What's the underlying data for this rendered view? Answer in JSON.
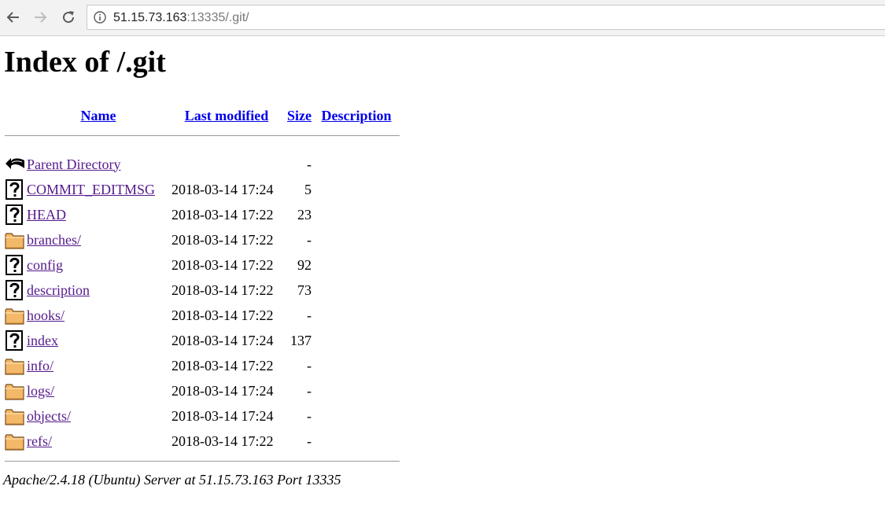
{
  "browser": {
    "url_host": "51.15.73.163",
    "url_rest": ":13335/.git/",
    "back_icon": "arrow-left-icon",
    "forward_icon": "arrow-right-icon",
    "reload_icon": "reload-icon",
    "info_icon": "info-circle-icon"
  },
  "page": {
    "title": "Index of /.git",
    "headers": {
      "name": "Name",
      "last_modified": "Last modified",
      "size": "Size",
      "description": "Description"
    },
    "entries": [
      {
        "icon": "back-arrow-icon",
        "name": "Parent Directory",
        "modified": "",
        "size": "-"
      },
      {
        "icon": "unknown-file-icon",
        "name": "COMMIT_EDITMSG",
        "modified": "2018-03-14 17:24",
        "size": "5"
      },
      {
        "icon": "unknown-file-icon",
        "name": "HEAD",
        "modified": "2018-03-14 17:22",
        "size": "23"
      },
      {
        "icon": "folder-icon",
        "name": "branches/",
        "modified": "2018-03-14 17:22",
        "size": "-"
      },
      {
        "icon": "unknown-file-icon",
        "name": "config",
        "modified": "2018-03-14 17:22",
        "size": "92"
      },
      {
        "icon": "unknown-file-icon",
        "name": "description",
        "modified": "2018-03-14 17:22",
        "size": "73"
      },
      {
        "icon": "folder-icon",
        "name": "hooks/",
        "modified": "2018-03-14 17:22",
        "size": "-"
      },
      {
        "icon": "unknown-file-icon",
        "name": "index",
        "modified": "2018-03-14 17:24",
        "size": "137"
      },
      {
        "icon": "folder-icon",
        "name": "info/",
        "modified": "2018-03-14 17:22",
        "size": "-"
      },
      {
        "icon": "folder-icon",
        "name": "logs/",
        "modified": "2018-03-14 17:24",
        "size": "-"
      },
      {
        "icon": "folder-icon",
        "name": "objects/",
        "modified": "2018-03-14 17:24",
        "size": "-"
      },
      {
        "icon": "folder-icon",
        "name": "refs/",
        "modified": "2018-03-14 17:22",
        "size": "-"
      }
    ],
    "footer": "Apache/2.4.18 (Ubuntu) Server at 51.15.73.163 Port 13335"
  },
  "colors": {
    "link": "#0000ee",
    "visited_link": "#551a8b",
    "folder": "#f4b869",
    "chrome": "#f2f2f2"
  }
}
